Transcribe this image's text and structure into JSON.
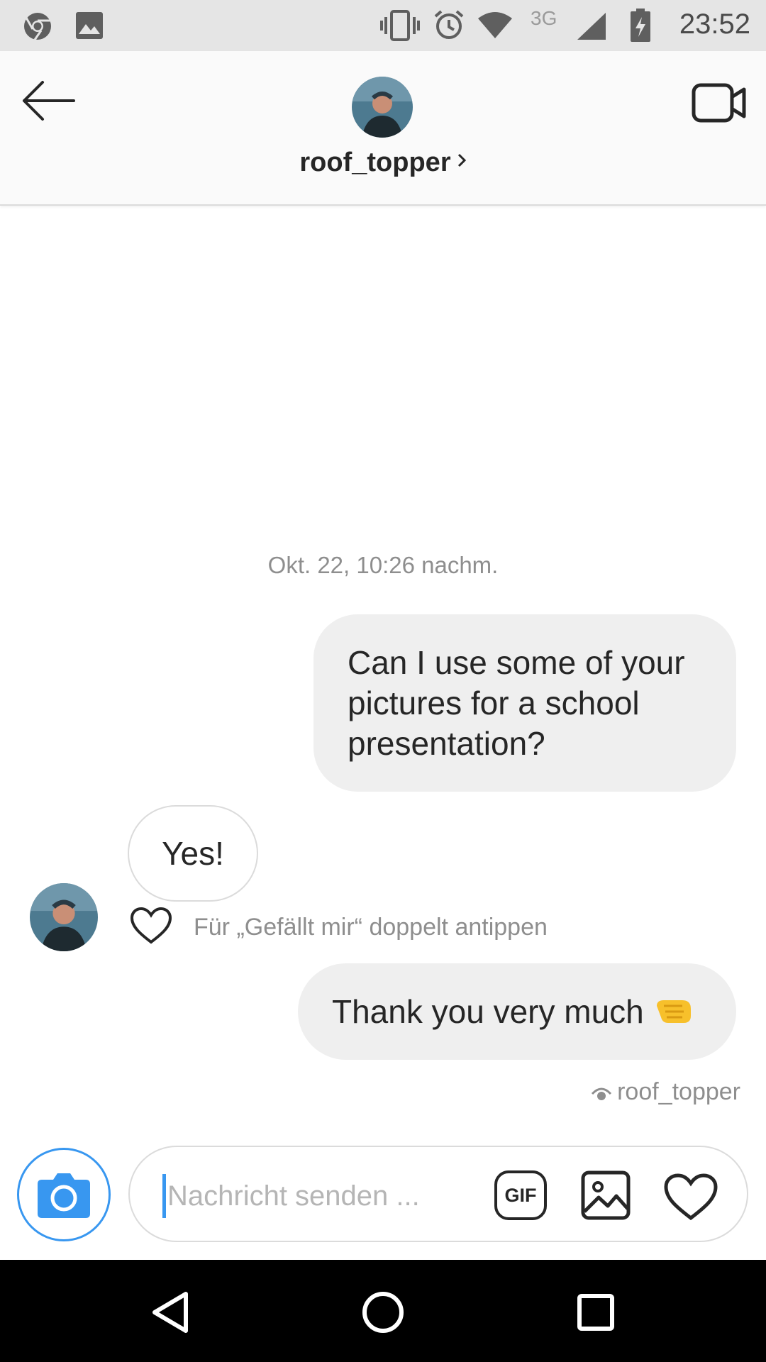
{
  "status_bar": {
    "time": "23:52",
    "network_type": "3G",
    "icons": [
      "chrome-icon",
      "gallery-icon",
      "vibrate-icon",
      "alarm-icon",
      "wifi-icon",
      "signal-icon",
      "battery-charging-icon"
    ]
  },
  "header": {
    "username": "roof_topper",
    "back_icon": "arrow-left-icon",
    "video_icon": "video-camera-icon"
  },
  "conversation": {
    "timestamp": "Okt. 22, 10:26 nachm.",
    "messages": [
      {
        "from": "me",
        "text": "Can I use some of your pictures for a school presentation?"
      },
      {
        "from": "roof_topper",
        "text": "Yes!"
      },
      {
        "from": "me",
        "text": "Thank you very much",
        "emoji": "left-facing-fist-icon"
      }
    ],
    "like_hint": "Für „Gefällt mir“ doppelt antippen",
    "seen_by": "roof_topper"
  },
  "composer": {
    "placeholder": "Nachricht senden ...",
    "value": "",
    "gif_label": "GIF"
  },
  "colors": {
    "accent": "#3897f0",
    "bubble": "#efefef",
    "muted_text": "#8e8e8e"
  }
}
